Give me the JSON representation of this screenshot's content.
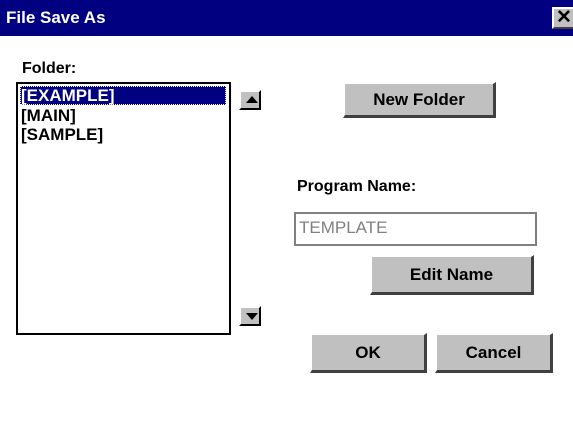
{
  "window": {
    "title": "File Save As",
    "close_glyph": "✕"
  },
  "folder": {
    "label": "Folder:",
    "items": [
      "[EXAMPLE]",
      "[MAIN]",
      "[SAMPLE]"
    ],
    "selected_index": 0
  },
  "buttons": {
    "new_folder": "New Folder",
    "edit_name": "Edit Name",
    "ok": "OK",
    "cancel": "Cancel"
  },
  "program": {
    "label": "Program Name:",
    "value": "TEMPLATE"
  },
  "icons": {
    "scroll_up": "scroll-up-arrow-icon",
    "scroll_down": "scroll-down-arrow-icon",
    "close": "close-icon"
  },
  "colors": {
    "titlebar": "#000080",
    "selection": "#000080",
    "button_face": "#c0c0c0",
    "disabled_text": "#808080"
  }
}
